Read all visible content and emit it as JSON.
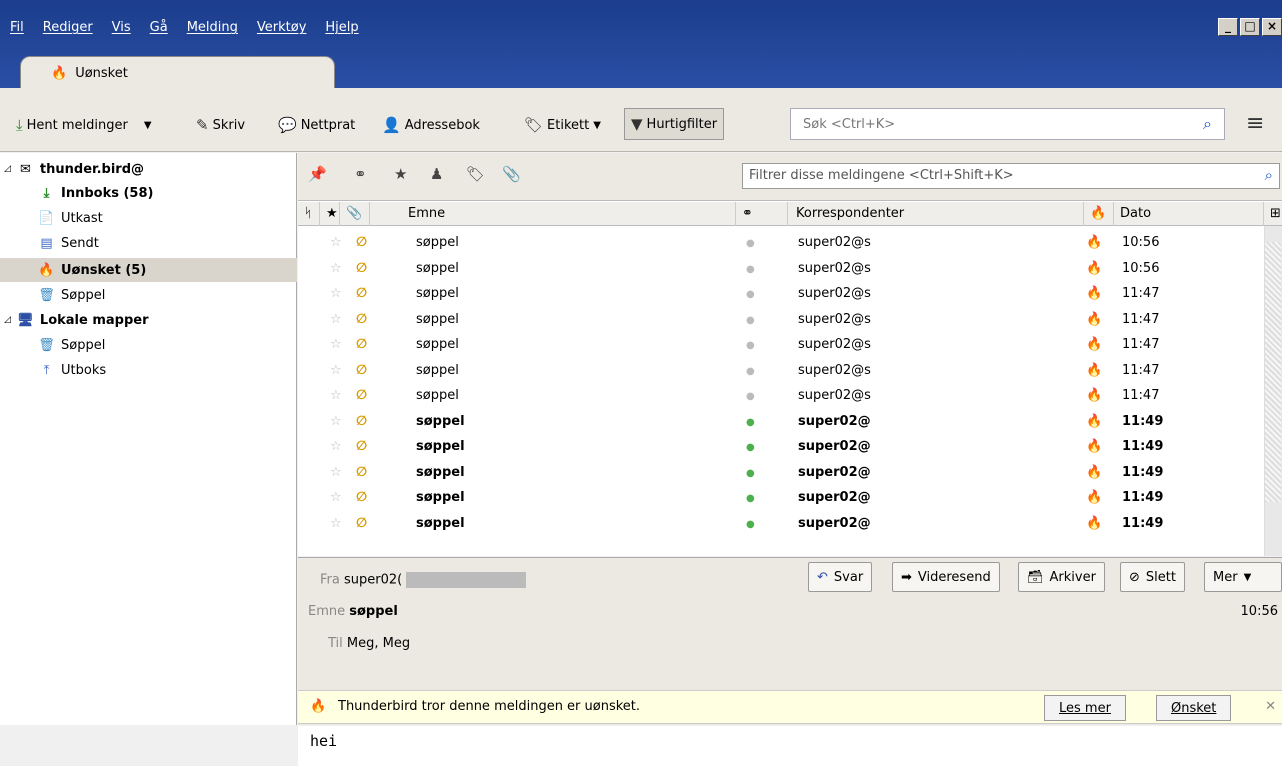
{
  "menu": {
    "items": [
      "Fil",
      "Rediger",
      "Vis",
      "Gå",
      "Melding",
      "Verktøy",
      "Hjelp"
    ]
  },
  "window": {
    "buttons": [
      "_",
      "□",
      "×"
    ]
  },
  "tab": {
    "label": "Uønsket"
  },
  "toolbar": {
    "get_messages": "Hent meldinger",
    "write": "Skriv",
    "chat": "Nettprat",
    "address_book": "Adressebok",
    "tag": "Etikett",
    "quick_filter": "Hurtigfilter",
    "search_placeholder": "Søk <Ctrl+K>"
  },
  "folders": {
    "account": "thunder.bird@",
    "inbox": "Innboks (58)",
    "drafts": "Utkast",
    "sent": "Sendt",
    "junk": "Uønsket (5)",
    "trash": "Søppel",
    "local": "Lokale mapper",
    "local_trash": "Søppel",
    "outbox": "Utboks"
  },
  "quickfilter": {
    "placeholder": "Filtrer disse meldingene <Ctrl+Shift+K>"
  },
  "columns": {
    "subject": "Emne",
    "correspondents": "Korrespondenter",
    "date": "Dato"
  },
  "messages": [
    {
      "subject": "søppel",
      "from": "super02@s",
      "time": "10:56",
      "unread": false
    },
    {
      "subject": "søppel",
      "from": "super02@s",
      "time": "10:56",
      "unread": false
    },
    {
      "subject": "søppel",
      "from": "super02@s",
      "time": "11:47",
      "unread": false
    },
    {
      "subject": "søppel",
      "from": "super02@s",
      "time": "11:47",
      "unread": false
    },
    {
      "subject": "søppel",
      "from": "super02@s",
      "time": "11:47",
      "unread": false
    },
    {
      "subject": "søppel",
      "from": "super02@s",
      "time": "11:47",
      "unread": false
    },
    {
      "subject": "søppel",
      "from": "super02@s",
      "time": "11:47",
      "unread": false
    },
    {
      "subject": "søppel",
      "from": "super02@",
      "time": "11:49",
      "unread": true
    },
    {
      "subject": "søppel",
      "from": "super02@",
      "time": "11:49",
      "unread": true
    },
    {
      "subject": "søppel",
      "from": "super02@",
      "time": "11:49",
      "unread": true
    },
    {
      "subject": "søppel",
      "from": "super02@",
      "time": "11:49",
      "unread": true
    },
    {
      "subject": "søppel",
      "from": "super02@",
      "time": "11:49",
      "unread": true
    }
  ],
  "header": {
    "from_label": "Fra",
    "from_value": "super02(",
    "subject_label": "Emne",
    "subject_value": "søppel",
    "to_label": "Til",
    "to_value": "Meg, Meg",
    "time": "10:56",
    "reply": "Svar",
    "forward": "Videresend",
    "archive": "Arkiver",
    "delete": "Slett",
    "more": "Mer"
  },
  "junkbar": {
    "text": "Thunderbird tror denne meldingen er uønsket.",
    "learn_more": "Les mer",
    "not_junk": "Ønsket"
  },
  "body": {
    "text": "hei"
  }
}
